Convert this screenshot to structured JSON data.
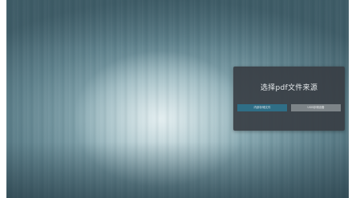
{
  "dialog": {
    "title": "选择pdf文件来源",
    "internal_button_label": "内部存储文件",
    "usb_button_label": "USB存储设备"
  },
  "colors": {
    "dialog_bg": "#383e44",
    "selected_button": "#2f6e86",
    "unselected_button": "#7d8488"
  }
}
